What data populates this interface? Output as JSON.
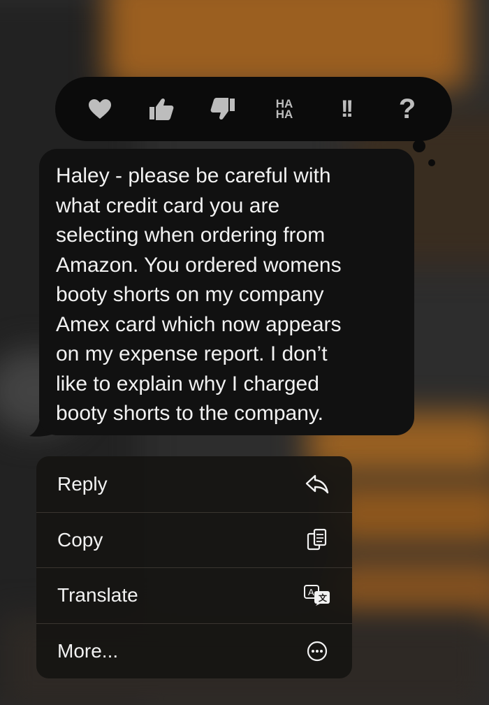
{
  "tapback": {
    "items": [
      {
        "name": "heart-icon"
      },
      {
        "name": "thumbs-up-icon"
      },
      {
        "name": "thumbs-down-icon"
      },
      {
        "name": "haha-icon",
        "line1": "HA",
        "line2": "HA"
      },
      {
        "name": "exclamation-icon",
        "text": "!!"
      },
      {
        "name": "question-icon",
        "text": "?"
      }
    ]
  },
  "message": {
    "lines": [
      "Haley - please be careful with",
      "what credit card you are",
      "selecting when ordering from",
      "Amazon. You ordered womens",
      "booty shorts on my company",
      "Amex card which now appears",
      "on my expense report. I  don’t",
      "like to explain why I charged",
      "booty shorts to the company."
    ]
  },
  "menu": {
    "items": [
      {
        "label": "Reply",
        "icon": "reply-icon"
      },
      {
        "label": "Copy",
        "icon": "copy-icon"
      },
      {
        "label": "Translate",
        "icon": "translate-icon"
      },
      {
        "label": "More...",
        "icon": "more-icon"
      }
    ]
  },
  "colors": {
    "bubble": "#111111",
    "tapback_bg": "#0b0b0b",
    "icon_gray": "#bdbdbd",
    "text": "#f2f2f2",
    "background_accent": "#c77a2a"
  }
}
